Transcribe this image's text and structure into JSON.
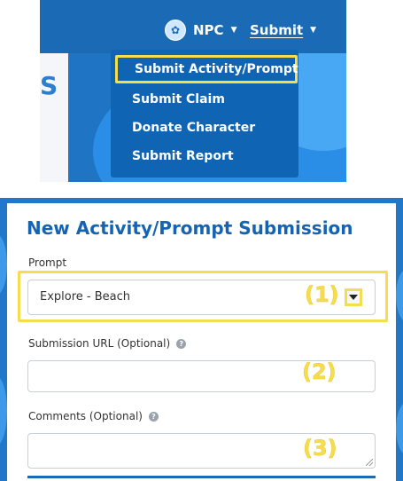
{
  "nav": {
    "npc_label": "NPC",
    "submit_label": "Submit",
    "menu_items": [
      "Submit Activity/Prompt",
      "Submit Claim",
      "Donate Character",
      "Submit Report"
    ]
  },
  "form": {
    "title": "New Activity/Prompt Submission",
    "prompt_label": "Prompt",
    "prompt_value": "Explore - Beach",
    "url_label": "Submission URL (Optional)",
    "comments_label": "Comments (Optional)",
    "help_glyph": "?",
    "steps": [
      "(1)",
      "(2)",
      "(3)"
    ]
  },
  "colors": {
    "brand_blue": "#1a6ab6",
    "highlight_yellow": "#f5dd4f",
    "title_blue": "#1564b4"
  },
  "icons": [
    "avatar-icon",
    "caret-down-icon",
    "help-icon",
    "dropdown-arrow-icon",
    "resize-grip-icon"
  ]
}
